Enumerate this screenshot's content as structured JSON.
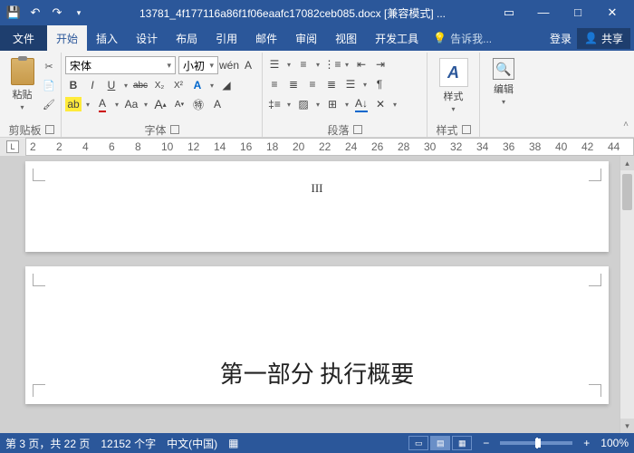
{
  "title": "13781_4f177116a86f1f06eaafc17082ceb085.docx [兼容模式] ...",
  "tabs": {
    "file": "文件",
    "home": "开始",
    "insert": "插入",
    "design": "设计",
    "layout": "布局",
    "references": "引用",
    "mailings": "邮件",
    "review": "审阅",
    "view": "视图",
    "developer": "开发工具"
  },
  "tell_me": "告诉我...",
  "login": "登录",
  "share": "共享",
  "groups": {
    "clipboard": "剪贴板",
    "font": "字体",
    "paragraph": "段落",
    "styles": "样式",
    "editing": "编辑"
  },
  "clipboard": {
    "paste": "粘贴"
  },
  "font": {
    "name": "宋体",
    "size": "小初",
    "wen": "wén",
    "bold": "B",
    "italic": "I",
    "underline": "U",
    "strike": "abc",
    "sub": "X₂",
    "sup": "X²",
    "clear": "A",
    "phonetic": "A",
    "border": "A"
  },
  "styles": {
    "label": "样式",
    "sample": "A"
  },
  "editing": {
    "label": "编辑"
  },
  "ruler": {
    "marks": [
      2,
      2,
      4,
      6,
      8,
      10,
      12,
      14,
      16,
      18,
      20,
      22,
      24,
      26,
      28,
      30,
      32,
      34,
      36,
      38,
      40,
      42,
      44
    ]
  },
  "doc": {
    "page_marker": "III",
    "heading": "第一部分  执行概要"
  },
  "status": {
    "page": "第 3 页，共 22 页",
    "words": "12152 个字",
    "lang": "中文(中国)",
    "zoom": "100%"
  }
}
